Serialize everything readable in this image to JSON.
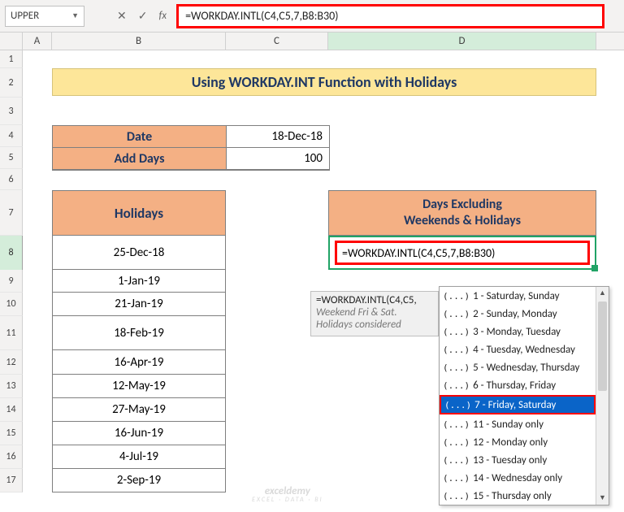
{
  "namebox": {
    "value": "UPPER"
  },
  "formula_bar": {
    "icons": {
      "cancel": "✕",
      "enter": "✓",
      "fx": "fx"
    },
    "formula": "=WORKDAY.INTL(C4,C5,7,B8:B30)"
  },
  "columns": [
    "A",
    "B",
    "C",
    "D"
  ],
  "row_numbers": [
    1,
    2,
    3,
    4,
    5,
    6,
    7,
    8,
    9,
    10,
    11,
    12,
    13,
    14,
    15,
    16,
    17
  ],
  "title": "Using WORKDAY.INT Function with Holidays",
  "inputs": {
    "rows": [
      {
        "label": "Date",
        "value": "18-Dec-18"
      },
      {
        "label": "Add Days",
        "value": "100"
      }
    ]
  },
  "holidays": {
    "header": "Holidays",
    "list": [
      "25-Dec-18",
      "1-Jan-19",
      "21-Jan-19",
      "18-Feb-19",
      "16-Apr-19",
      "12-May-19",
      "27-May-19",
      "16-Jun-19",
      "4-Jul-19",
      "2-Sep-19"
    ]
  },
  "result": {
    "header_l1": "Days Excluding",
    "header_l2": "Weekends & Holidays",
    "cell_formula": "=WORKDAY.INTL(C4,C5,7,B8:B30)"
  },
  "tooltip": {
    "line1": "=WORKDAY.INTL(C4,C5,",
    "line2": "Weekend Fri & Sat.",
    "line3": "Holidays considered"
  },
  "dropdown": {
    "selected_index": 6,
    "items": [
      "1 - Saturday, Sunday",
      "2 - Sunday, Monday",
      "3 - Monday, Tuesday",
      "4 - Tuesday, Wednesday",
      "5 - Wednesday, Thursday",
      "6 - Thursday, Friday",
      "7 - Friday, Saturday",
      "11 - Sunday only",
      "12 - Monday only",
      "13 - Tuesday only",
      "14 - Wednesday only",
      "15 - Thursday only"
    ]
  },
  "watermark": {
    "brand": "exceldemy",
    "sub": "EXCEL · DATA · BI"
  }
}
